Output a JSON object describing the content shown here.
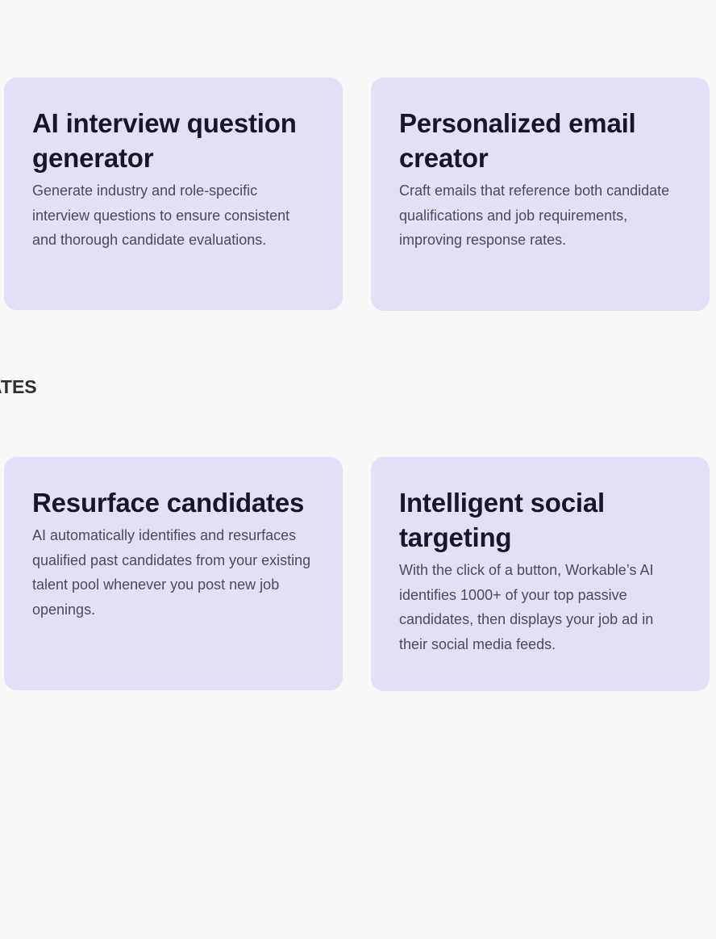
{
  "cards_top": [
    {
      "title": "AI interview question generator",
      "description": "Generate industry and role-specific interview questions to ensure consistent and thorough candidate evaluations."
    },
    {
      "title": "Personalized email creator",
      "description": "Craft emails that reference both candidate qualifications and job requirements, improving response rates."
    }
  ],
  "section": {
    "heading_partial": "ATES"
  },
  "cards_bottom": [
    {
      "title": "Resurface candidates",
      "description": "AI automatically identifies and resurfaces qualified past candidates from your existing talent pool whenever you post new job openings."
    },
    {
      "title": "Intelligent social targeting",
      "description": "With the click of a button, Workable’s AI identifies 1000+ of your top passive candidates, then displays your job ad in their social media feeds."
    }
  ],
  "colors": {
    "page_background": "#f9f8f6",
    "card_background": "#e4dff9",
    "title_text": "#161626",
    "body_text": "#4a4a5e"
  }
}
